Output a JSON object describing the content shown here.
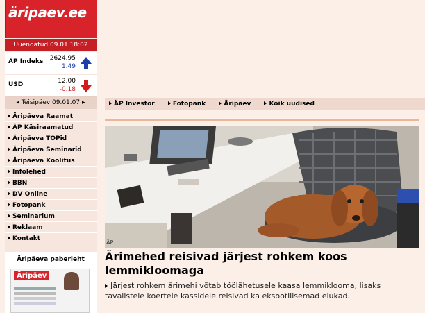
{
  "logo": {
    "text": "äripaev.ee"
  },
  "updated": "Uuendatud 09.01 18:02",
  "tickers": [
    {
      "name": "ÄP Indeks",
      "value": "2624.95",
      "change": "1.49",
      "direction": "up"
    },
    {
      "name": "USD",
      "value": "12.00",
      "change": "-0.18",
      "direction": "down"
    }
  ],
  "date_bar": "Teisipäev 09.01.07",
  "menu": [
    "Äripäeva Raamat",
    "ÄP Käsiraamatud",
    "Äripäeva TOPid",
    "Äripäeva Seminarid",
    "Äripäeva Koolitus",
    "Infolehed",
    "BBN",
    "DV Online",
    "Fotopank",
    "Seminarium",
    "Reklaam",
    "Kontakt"
  ],
  "paper": {
    "title": "Äripäeva paberleht",
    "logo": "Äripäev"
  },
  "topnav": [
    "ÄP Investor",
    "Fotopank",
    "Äripäev",
    "Kõik uudised"
  ],
  "article": {
    "photo_credit": "ÄP",
    "headline": "Ärimehed reisivad järjest rohkem koos lemmikloomaga",
    "lead": "Järjest rohkem ärimehi võtab töölähetusele kaasa lemmiklooma, lisaks tavalistele koertele kassidele reisivad ka eksootilisemad elukad."
  },
  "colors": {
    "brand": "#d8232a",
    "up": "#1f3fa8",
    "down": "#d31b1b"
  }
}
